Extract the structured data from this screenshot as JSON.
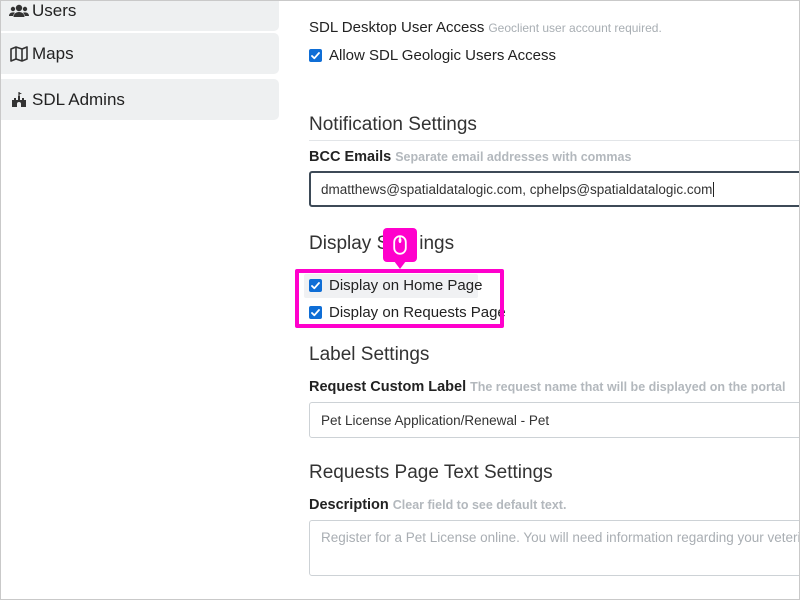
{
  "sidebar": {
    "items": [
      {
        "label": "Users",
        "icon": "users-icon"
      },
      {
        "label": "Maps",
        "icon": "map-icon"
      },
      {
        "label": "SDL Admins",
        "icon": "castle-icon"
      }
    ]
  },
  "access": {
    "title": "SDL Desktop User Access",
    "hint": "Geoclient user account required.",
    "allow_label": "Allow SDL Geologic Users Access",
    "allow_checked": true
  },
  "notification": {
    "title": "Notification Settings",
    "bcc_label": "BCC Emails",
    "bcc_hint": "Separate email addresses with commas",
    "bcc_value": "dmatthews@spatialdatalogic.com, cphelps@spatialdatalogic.com"
  },
  "display": {
    "title_start": "Display S",
    "title_end": "ings",
    "home_label": "Display on Home Page",
    "home_checked": true,
    "requests_label": "Display on Requests Page",
    "requests_checked": true
  },
  "label_settings": {
    "title": "Label Settings",
    "custom_label": "Request Custom Label",
    "custom_hint": "The request name that will be displayed on the portal",
    "custom_value": "Pet License Application/Renewal - Pet"
  },
  "requests_text": {
    "title": "Requests Page Text Settings",
    "desc_label": "Description",
    "desc_hint": "Clear field to see default text.",
    "desc_placeholder": "Register for a Pet License online. You will need information regarding your veterinarian"
  },
  "colors": {
    "accent": "#0f6ed6",
    "highlight": "#ff00cc",
    "nav_bg": "#eef0f1"
  }
}
